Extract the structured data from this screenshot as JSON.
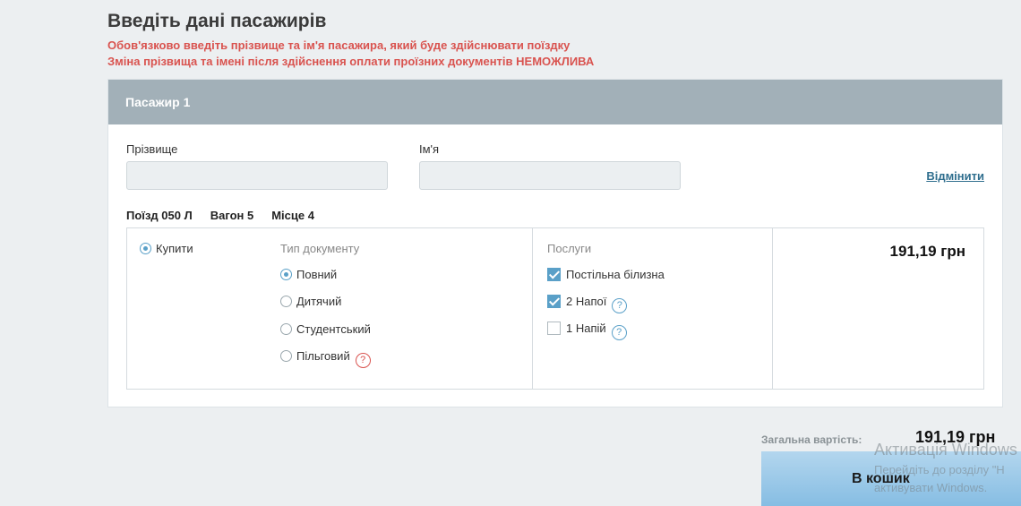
{
  "page": {
    "title": "Введіть дані пасажирів",
    "warning_1": "Обов'язково введіть прізвище та ім'я пасажира, який буде здійснювати поїздку",
    "warning_2": "Зміна прізвища та імені після здійснення оплати проїзних документів НЕМОЖЛИВА"
  },
  "passenger": {
    "header": "Пасажир 1",
    "surname_label": "Прізвище",
    "surname_value": "",
    "name_label": "Ім'я",
    "name_value": "",
    "cancel_label": "Відмінити",
    "train": "Поїзд 050 Л",
    "wagon": "Вагон 5",
    "seat": "Місце 4",
    "buy_label": "Купити",
    "doc_type_title": "Тип документу",
    "doc_types": [
      {
        "label": "Повний",
        "selected": true
      },
      {
        "label": "Дитячий",
        "selected": false
      },
      {
        "label": "Студентський",
        "selected": false
      },
      {
        "label": "Пільговий",
        "selected": false
      }
    ],
    "services_title": "Послуги",
    "services": [
      {
        "label": "Постільна білизна",
        "checked": true
      },
      {
        "label": "2 Напої",
        "checked": true
      },
      {
        "label": "1 Напій",
        "checked": false
      }
    ],
    "price": "191,19 грн"
  },
  "summary": {
    "total_label": "Загальна вартість:",
    "total_value": "191,19 грн",
    "cart_button": "В кошик"
  },
  "watermark": {
    "line1": "Активація Windows",
    "line2": "Перейдіть до розділу \"Н",
    "line3": "активувати Windows."
  },
  "colors": {
    "warning": "#d9534f",
    "header_bg": "#a2b0b8",
    "accent": "#5aa0c8",
    "link": "#2f6e8e"
  },
  "icons": {
    "help": "question-circle-icon"
  }
}
